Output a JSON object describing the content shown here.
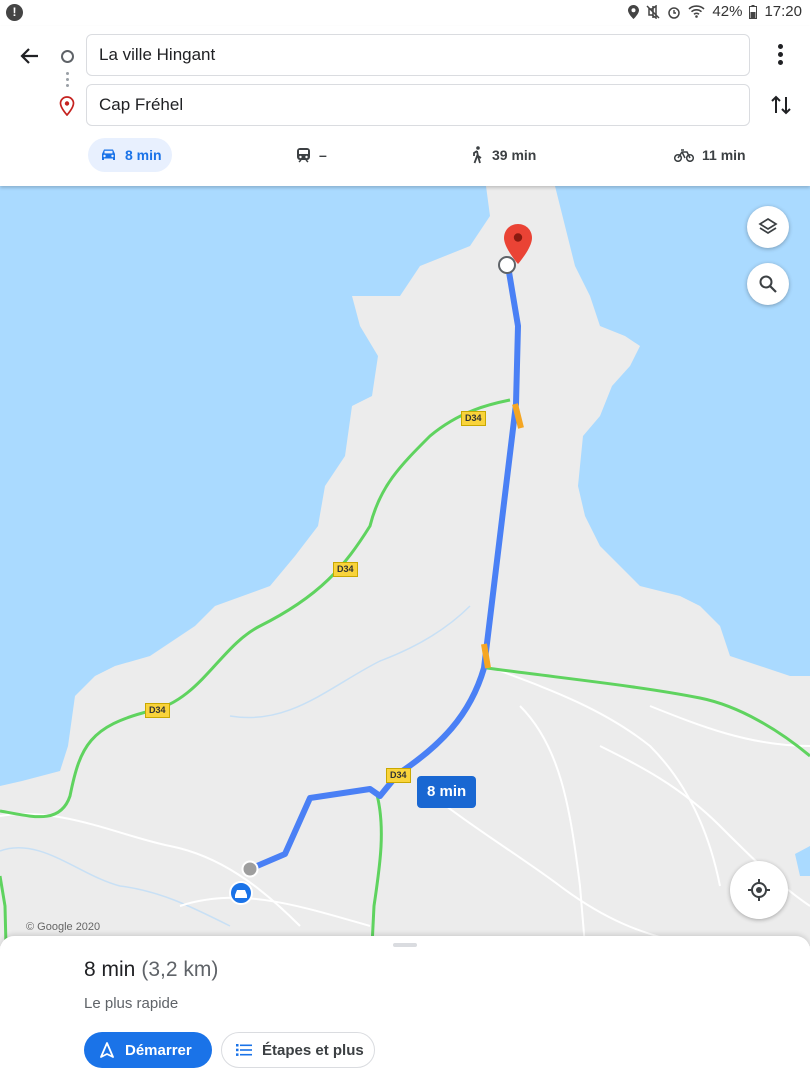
{
  "status_bar": {
    "battery": "42%",
    "time": "17:20"
  },
  "directions": {
    "origin": "La ville Hingant",
    "destination": "Cap Fréhel"
  },
  "modes": {
    "drive": "8 min",
    "transit": "–",
    "walk": "39 min",
    "bike": "11 min"
  },
  "map": {
    "road_labels": [
      "D34",
      "D34",
      "D34",
      "D34"
    ],
    "route_time": "8 min",
    "copyright": "© Google 2020",
    "colors": {
      "water": "#aadaff",
      "land": "#ececec",
      "route": "#4a80f5",
      "route_slow": "#f5a623",
      "main_road": "#5fd35f",
      "pin": "#ea4335"
    }
  },
  "sheet": {
    "duration": "8 min",
    "distance": "(3,2 km)",
    "subtitle": "Le plus rapide",
    "start_label": "Démarrer",
    "steps_label": "Étapes et plus"
  }
}
